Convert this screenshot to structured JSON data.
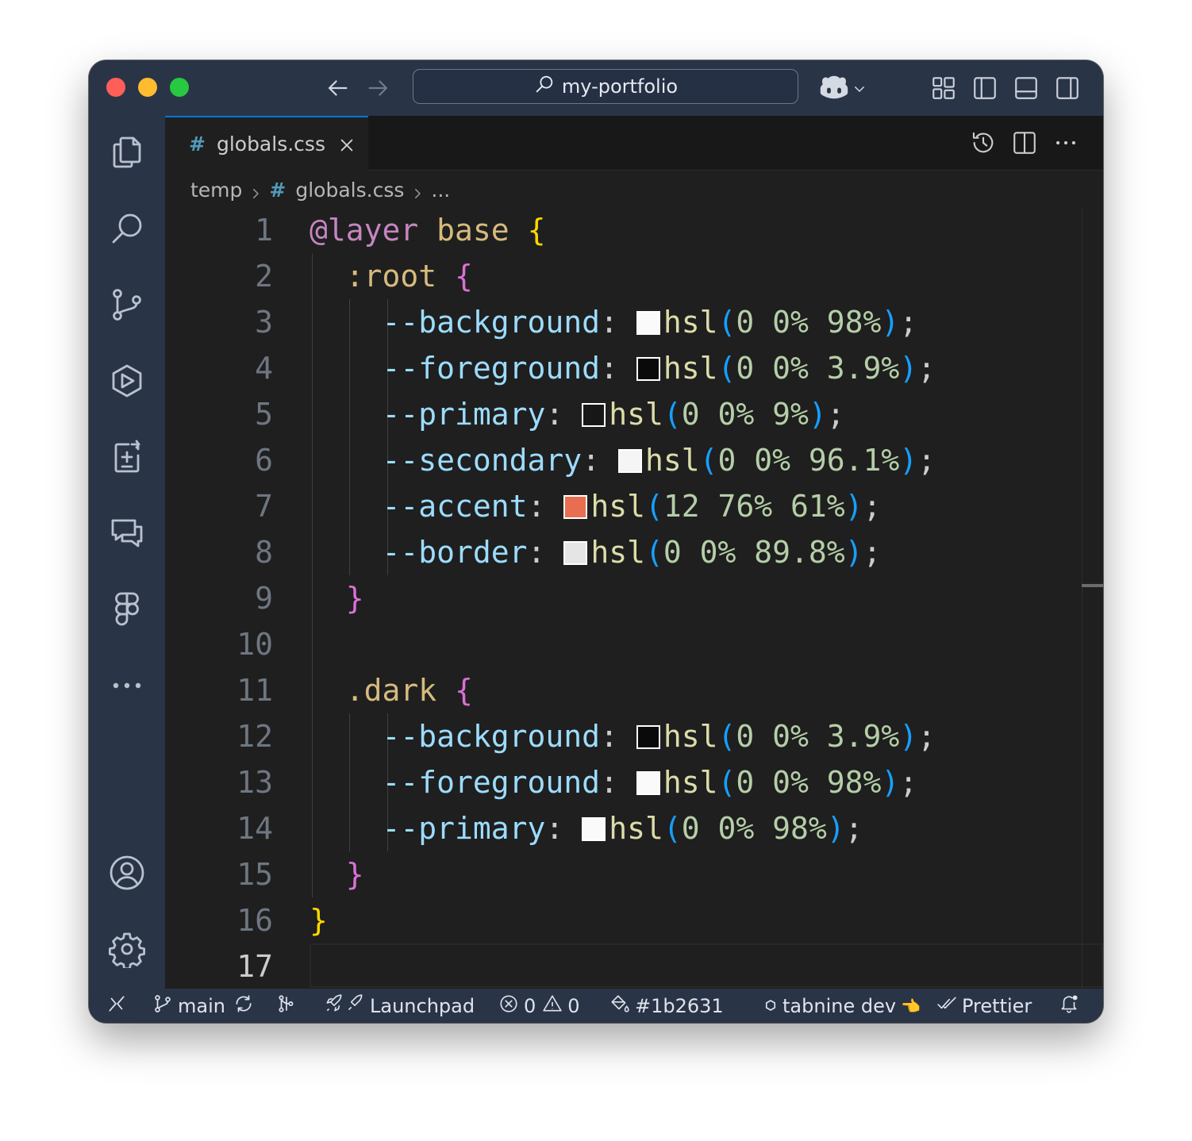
{
  "titlebar": {
    "search_text": "my-portfolio"
  },
  "activity_bar": {
    "items": [
      "explorer-icon",
      "search-icon",
      "source-control-icon",
      "run-debug-icon",
      "testing-icon",
      "chat-icon",
      "figma-icon",
      "more-icon"
    ],
    "bottom": [
      "account-icon",
      "settings-gear-icon"
    ]
  },
  "tab": {
    "icon_text": "#",
    "label": "globals.css"
  },
  "breadcrumb": {
    "folder": "temp",
    "file_icon_text": "#",
    "file": "globals.css",
    "trail": "..."
  },
  "editor": {
    "line_numbers": [
      "1",
      "2",
      "3",
      "4",
      "5",
      "6",
      "7",
      "8",
      "9",
      "10",
      "11",
      "12",
      "13",
      "14",
      "15",
      "16",
      "17"
    ],
    "current_line": "17",
    "lines": [
      {
        "kw": "@layer",
        "sel": "base",
        "open": "{"
      },
      {
        "sel": ":root",
        "open": "{"
      },
      {
        "prop": "--background",
        "swatch": "#fafafa",
        "fn": "hsl",
        "args": "0 0% 98%"
      },
      {
        "prop": "--foreground",
        "swatch": "#0a0a0a",
        "fn": "hsl",
        "args": "0 0% 3.9%"
      },
      {
        "prop": "--primary",
        "swatch": "#171717",
        "fn": "hsl",
        "args": "0 0% 9%"
      },
      {
        "prop": "--secondary",
        "swatch": "#f5f5f5",
        "fn": "hsl",
        "args": "0 0% 96.1%"
      },
      {
        "prop": "--accent",
        "swatch": "#e76e50",
        "fn": "hsl",
        "args": "12 76% 61%"
      },
      {
        "prop": "--border",
        "swatch": "#e5e5e5",
        "fn": "hsl",
        "args": "0 0% 89.8%"
      },
      {
        "close": "}"
      },
      {},
      {
        "sel": ".dark",
        "open": "{"
      },
      {
        "prop": "--background",
        "swatch": "#0a0a0a",
        "fn": "hsl",
        "args": "0 0% 3.9%"
      },
      {
        "prop": "--foreground",
        "swatch": "#fafafa",
        "fn": "hsl",
        "args": "0 0% 98%"
      },
      {
        "prop": "--primary",
        "swatch": "#fafafa",
        "fn": "hsl",
        "args": "0 0% 98%"
      },
      {
        "close": "}"
      },
      {
        "close": "}"
      },
      {}
    ]
  },
  "statusbar": {
    "branch": "main",
    "launchpad": "Launchpad",
    "errors": "0",
    "warnings": "0",
    "color": "#1b2631",
    "tabnine": "tabnine dev",
    "tabnine_emoji": "👈",
    "prettier": "Prettier"
  },
  "colors": {
    "chrome": "#2a3447",
    "editor_bg": "#1f1f1f",
    "accent_tab": "#0078d4"
  }
}
